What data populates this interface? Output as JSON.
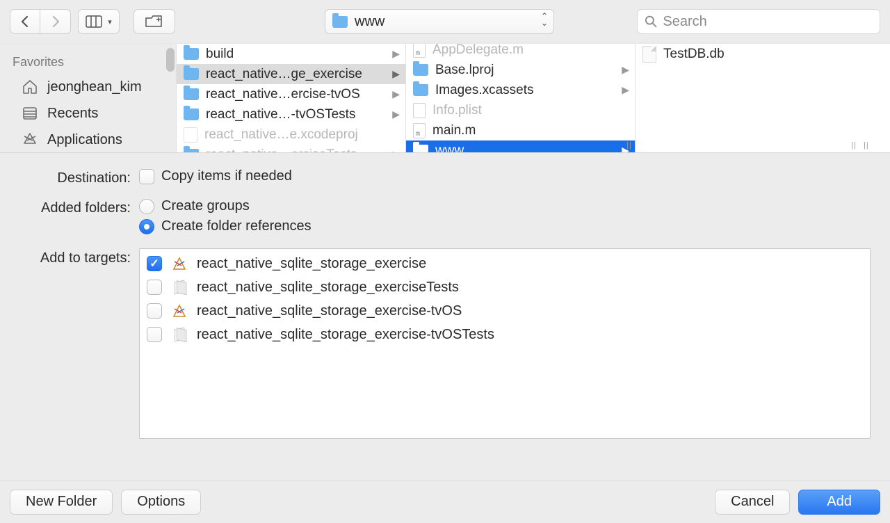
{
  "toolbar": {
    "path_label": "www",
    "search_placeholder": "Search"
  },
  "sidebar": {
    "header": "Favorites",
    "items": [
      {
        "icon": "home",
        "label": "jeonghean_kim"
      },
      {
        "icon": "recents",
        "label": "Recents"
      },
      {
        "icon": "apps",
        "label": "Applications"
      }
    ]
  },
  "columns": {
    "col1": [
      {
        "type": "folder",
        "label": "build",
        "arrow": true,
        "dim": false,
        "sel": false
      },
      {
        "type": "folder",
        "label": "react_native…ge_exercise",
        "arrow": true,
        "dim": false,
        "sel": true
      },
      {
        "type": "folder",
        "label": "react_native…ercise-tvOS",
        "arrow": true,
        "dim": false,
        "sel": false
      },
      {
        "type": "folder",
        "label": "react_native…-tvOSTests",
        "arrow": true,
        "dim": false,
        "sel": false
      },
      {
        "type": "proj",
        "label": "react_native…e.xcodeproj",
        "arrow": false,
        "dim": true,
        "sel": false
      },
      {
        "type": "folder",
        "label": "react_native…erciseTests",
        "arrow": true,
        "dim": true,
        "sel": false
      }
    ],
    "col2": [
      {
        "type": "file-m",
        "label": "AppDelegate.m",
        "arrow": false,
        "dim": true,
        "sel": false
      },
      {
        "type": "folder",
        "label": "Base.lproj",
        "arrow": true,
        "dim": false,
        "sel": false
      },
      {
        "type": "folder",
        "label": "Images.xcassets",
        "arrow": true,
        "dim": false,
        "sel": false
      },
      {
        "type": "file",
        "label": "Info.plist",
        "arrow": false,
        "dim": true,
        "sel": false
      },
      {
        "type": "file-m",
        "label": "main.m",
        "arrow": false,
        "dim": false,
        "sel": false
      },
      {
        "type": "folder",
        "label": "www",
        "arrow": true,
        "dim": false,
        "sel": true,
        "hard": true
      }
    ],
    "col3": [
      {
        "type": "blank",
        "label": "TestDB.db",
        "arrow": false,
        "dim": false,
        "sel": false
      }
    ]
  },
  "options": {
    "destination_label": "Destination:",
    "copy_items_label": "Copy items if needed",
    "copy_items_checked": false,
    "added_folders_label": "Added folders:",
    "radio_groups_label": "Create groups",
    "radio_refs_label": "Create folder references",
    "radio_selected": "refs",
    "targets_label": "Add to targets:",
    "targets": [
      {
        "checked": true,
        "icon": "app",
        "label": "react_native_sqlite_storage_exercise"
      },
      {
        "checked": false,
        "icon": "test",
        "label": "react_native_sqlite_storage_exerciseTests"
      },
      {
        "checked": false,
        "icon": "app",
        "label": "react_native_sqlite_storage_exercise-tvOS"
      },
      {
        "checked": false,
        "icon": "test",
        "label": "react_native_sqlite_storage_exercise-tvOSTests"
      }
    ]
  },
  "footer": {
    "new_folder": "New Folder",
    "options": "Options",
    "cancel": "Cancel",
    "add": "Add"
  }
}
